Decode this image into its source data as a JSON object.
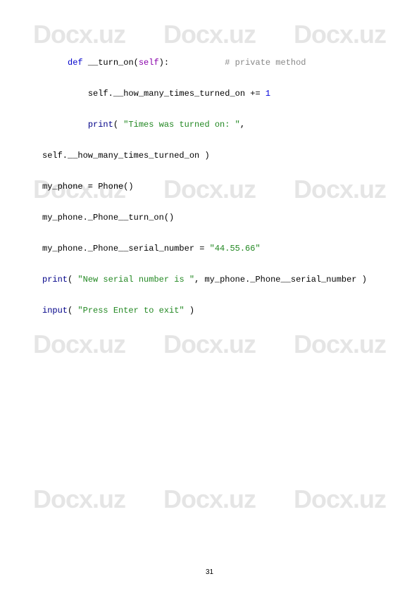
{
  "watermark": "Docx.uz",
  "page_number": "31",
  "code": {
    "line1": {
      "indent": "     ",
      "def": "def",
      "space1": " ",
      "method": "__turn_on",
      "paren_open": "(",
      "self": "self",
      "paren_close": "):",
      "comment_spacing": "           ",
      "comment": "# private method"
    },
    "line2": {
      "indent": "         ",
      "text": "self.__how_many_times_turned_on += ",
      "number": "1"
    },
    "line3": {
      "indent": "         ",
      "print": "print",
      "paren_open": "( ",
      "string": "\"Times was turned on: \"",
      "rest": ", "
    },
    "line4": {
      "text": "self.__how_many_times_turned_on )"
    },
    "line5": {
      "text": "my_phone = Phone()"
    },
    "line6": {
      "text": "my_phone._Phone__turn_on()"
    },
    "line7": {
      "text": "my_phone._Phone__serial_number = ",
      "string": "\"44.55.66\""
    },
    "line8": {
      "print": "print",
      "paren_open": "( ",
      "string": "\"New serial number is \"",
      "rest": ", my_phone._Phone__serial_number )"
    },
    "line9": {
      "input": "input",
      "paren_open": "( ",
      "string": "\"Press Enter to exit\"",
      "rest": " )"
    }
  }
}
